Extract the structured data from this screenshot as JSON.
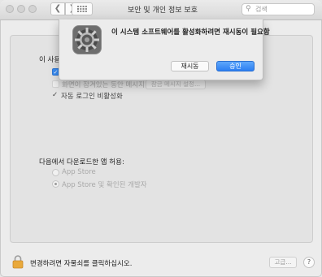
{
  "window": {
    "title": "보안 및 개인 정보 보호",
    "search_placeholder": "검색"
  },
  "general": {
    "section_label": "이 사용자",
    "lock_message_label": "화면이 잠겨있는 동안 메시지 표시",
    "set_message_button": "잠금 메시지 설정...",
    "disable_autologin_label": "자동 로그인 비활성화",
    "disable_autologin_checked": true
  },
  "downloads": {
    "heading": "다음에서 다운로드한 앱 허용:",
    "options": [
      "App Store",
      "App Store 및 확인된 개발자"
    ],
    "selected_index": 1
  },
  "footer": {
    "lock_message": "변경하려면 자물쇠를 클릭하십시오.",
    "advanced_button": "고급...",
    "help_button": "?"
  },
  "alert": {
    "message": "이 시스템 소프트웨어를 활성화하려면 재시동이 필요함",
    "restart_button": "재시동",
    "approve_button": "승인"
  },
  "colors": {
    "accent": "#2c7ef2",
    "lock": "#e9a93b"
  }
}
